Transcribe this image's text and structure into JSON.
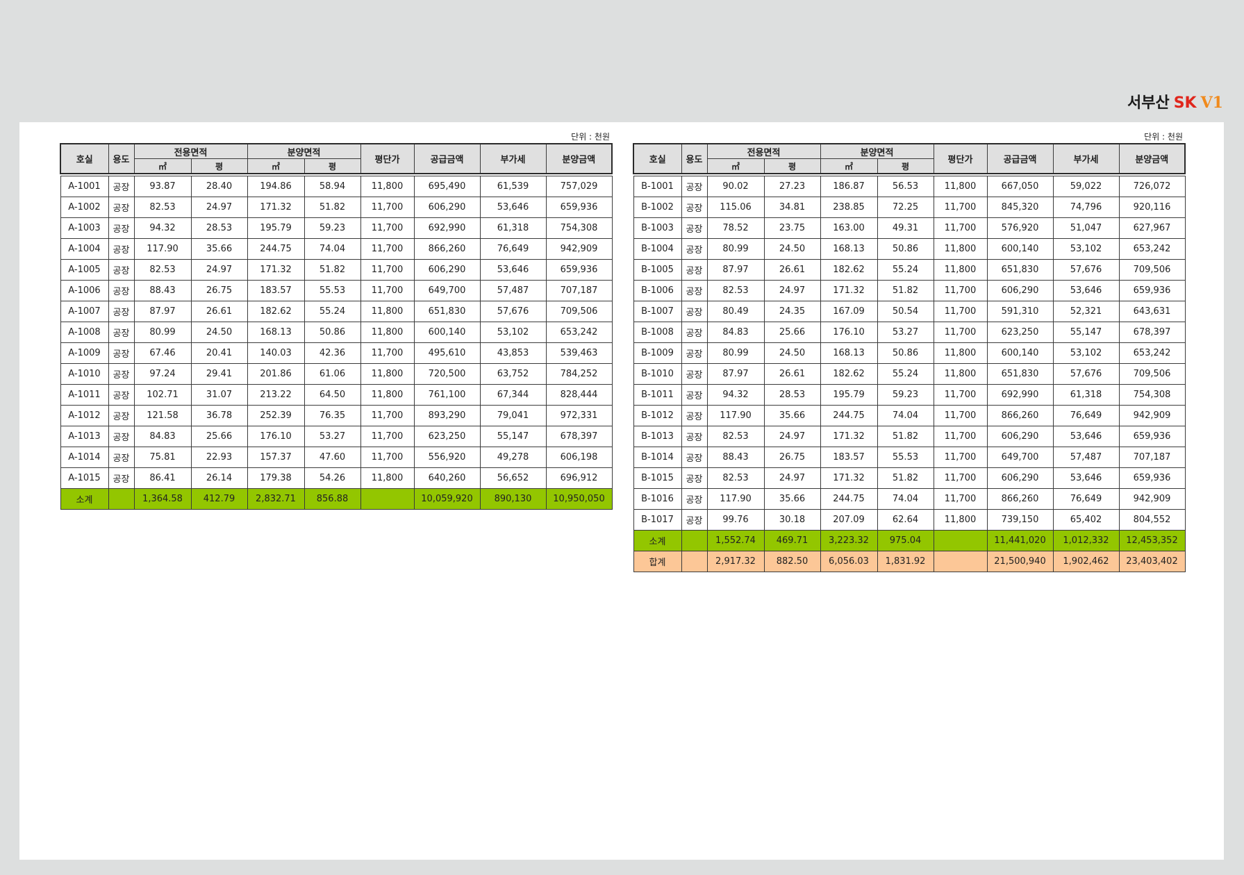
{
  "brand": {
    "text1": "서부산",
    "text2": "SK",
    "text3": "V1"
  },
  "unit_label": "단위 : 천원",
  "headers": {
    "room": "호실",
    "use": "용도",
    "exclusive_area": "전용면적",
    "sale_area": "분양면적",
    "sqm": "㎡",
    "pyeong": "평",
    "unit_price": "평단가",
    "supply_price": "공급금액",
    "vat": "부가세",
    "sale_price": "분양금액"
  },
  "tables": [
    {
      "rows": [
        [
          "A-1001",
          "공장",
          "93.87",
          "28.40",
          "194.86",
          "58.94",
          "11,800",
          "695,490",
          "61,539",
          "757,029"
        ],
        [
          "A-1002",
          "공장",
          "82.53",
          "24.97",
          "171.32",
          "51.82",
          "11,700",
          "606,290",
          "53,646",
          "659,936"
        ],
        [
          "A-1003",
          "공장",
          "94.32",
          "28.53",
          "195.79",
          "59.23",
          "11,700",
          "692,990",
          "61,318",
          "754,308"
        ],
        [
          "A-1004",
          "공장",
          "117.90",
          "35.66",
          "244.75",
          "74.04",
          "11,700",
          "866,260",
          "76,649",
          "942,909"
        ],
        [
          "A-1005",
          "공장",
          "82.53",
          "24.97",
          "171.32",
          "51.82",
          "11,700",
          "606,290",
          "53,646",
          "659,936"
        ],
        [
          "A-1006",
          "공장",
          "88.43",
          "26.75",
          "183.57",
          "55.53",
          "11,700",
          "649,700",
          "57,487",
          "707,187"
        ],
        [
          "A-1007",
          "공장",
          "87.97",
          "26.61",
          "182.62",
          "55.24",
          "11,800",
          "651,830",
          "57,676",
          "709,506"
        ],
        [
          "A-1008",
          "공장",
          "80.99",
          "24.50",
          "168.13",
          "50.86",
          "11,800",
          "600,140",
          "53,102",
          "653,242"
        ],
        [
          "A-1009",
          "공장",
          "67.46",
          "20.41",
          "140.03",
          "42.36",
          "11,700",
          "495,610",
          "43,853",
          "539,463"
        ],
        [
          "A-1010",
          "공장",
          "97.24",
          "29.41",
          "201.86",
          "61.06",
          "11,800",
          "720,500",
          "63,752",
          "784,252"
        ],
        [
          "A-1011",
          "공장",
          "102.71",
          "31.07",
          "213.22",
          "64.50",
          "11,800",
          "761,100",
          "67,344",
          "828,444"
        ],
        [
          "A-1012",
          "공장",
          "121.58",
          "36.78",
          "252.39",
          "76.35",
          "11,700",
          "893,290",
          "79,041",
          "972,331"
        ],
        [
          "A-1013",
          "공장",
          "84.83",
          "25.66",
          "176.10",
          "53.27",
          "11,700",
          "623,250",
          "55,147",
          "678,397"
        ],
        [
          "A-1014",
          "공장",
          "75.81",
          "22.93",
          "157.37",
          "47.60",
          "11,700",
          "556,920",
          "49,278",
          "606,198"
        ],
        [
          "A-1015",
          "공장",
          "86.41",
          "26.14",
          "179.38",
          "54.26",
          "11,800",
          "640,260",
          "56,652",
          "696,912"
        ]
      ],
      "summary": [
        {
          "kind": "sub",
          "cells": [
            "소계",
            "",
            "1,364.58",
            "412.79",
            "2,832.71",
            "856.88",
            "",
            "10,059,920",
            "890,130",
            "10,950,050"
          ]
        }
      ]
    },
    {
      "rows": [
        [
          "B-1001",
          "공장",
          "90.02",
          "27.23",
          "186.87",
          "56.53",
          "11,800",
          "667,050",
          "59,022",
          "726,072"
        ],
        [
          "B-1002",
          "공장",
          "115.06",
          "34.81",
          "238.85",
          "72.25",
          "11,700",
          "845,320",
          "74,796",
          "920,116"
        ],
        [
          "B-1003",
          "공장",
          "78.52",
          "23.75",
          "163.00",
          "49.31",
          "11,700",
          "576,920",
          "51,047",
          "627,967"
        ],
        [
          "B-1004",
          "공장",
          "80.99",
          "24.50",
          "168.13",
          "50.86",
          "11,800",
          "600,140",
          "53,102",
          "653,242"
        ],
        [
          "B-1005",
          "공장",
          "87.97",
          "26.61",
          "182.62",
          "55.24",
          "11,800",
          "651,830",
          "57,676",
          "709,506"
        ],
        [
          "B-1006",
          "공장",
          "82.53",
          "24.97",
          "171.32",
          "51.82",
          "11,700",
          "606,290",
          "53,646",
          "659,936"
        ],
        [
          "B-1007",
          "공장",
          "80.49",
          "24.35",
          "167.09",
          "50.54",
          "11,700",
          "591,310",
          "52,321",
          "643,631"
        ],
        [
          "B-1008",
          "공장",
          "84.83",
          "25.66",
          "176.10",
          "53.27",
          "11,700",
          "623,250",
          "55,147",
          "678,397"
        ],
        [
          "B-1009",
          "공장",
          "80.99",
          "24.50",
          "168.13",
          "50.86",
          "11,800",
          "600,140",
          "53,102",
          "653,242"
        ],
        [
          "B-1010",
          "공장",
          "87.97",
          "26.61",
          "182.62",
          "55.24",
          "11,800",
          "651,830",
          "57,676",
          "709,506"
        ],
        [
          "B-1011",
          "공장",
          "94.32",
          "28.53",
          "195.79",
          "59.23",
          "11,700",
          "692,990",
          "61,318",
          "754,308"
        ],
        [
          "B-1012",
          "공장",
          "117.90",
          "35.66",
          "244.75",
          "74.04",
          "11,700",
          "866,260",
          "76,649",
          "942,909"
        ],
        [
          "B-1013",
          "공장",
          "82.53",
          "24.97",
          "171.32",
          "51.82",
          "11,700",
          "606,290",
          "53,646",
          "659,936"
        ],
        [
          "B-1014",
          "공장",
          "88.43",
          "26.75",
          "183.57",
          "55.53",
          "11,700",
          "649,700",
          "57,487",
          "707,187"
        ],
        [
          "B-1015",
          "공장",
          "82.53",
          "24.97",
          "171.32",
          "51.82",
          "11,700",
          "606,290",
          "53,646",
          "659,936"
        ],
        [
          "B-1016",
          "공장",
          "117.90",
          "35.66",
          "244.75",
          "74.04",
          "11,700",
          "866,260",
          "76,649",
          "942,909"
        ],
        [
          "B-1017",
          "공장",
          "99.76",
          "30.18",
          "207.09",
          "62.64",
          "11,800",
          "739,150",
          "65,402",
          "804,552"
        ]
      ],
      "summary": [
        {
          "kind": "sub",
          "cells": [
            "소계",
            "",
            "1,552.74",
            "469.71",
            "3,223.32",
            "975.04",
            "",
            "11,441,020",
            "1,012,332",
            "12,453,352"
          ]
        },
        {
          "kind": "total",
          "cells": [
            "합계",
            "",
            "2,917.32",
            "882.50",
            "6,056.03",
            "1,831.92",
            "",
            "21,500,940",
            "1,902,462",
            "23,403,402"
          ]
        }
      ]
    }
  ]
}
